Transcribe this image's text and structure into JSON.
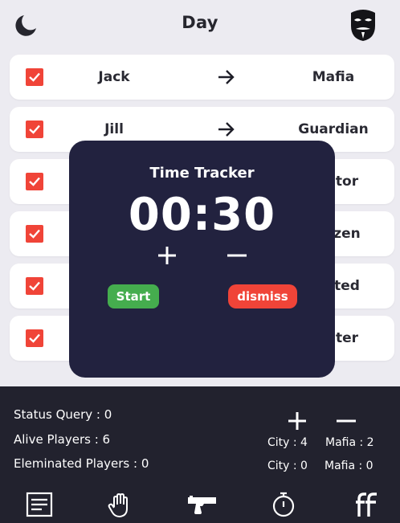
{
  "header": {
    "title": "Day",
    "left_icon": "moon-icon",
    "right_icon": "mask-icon"
  },
  "players": [
    {
      "name": "Jack",
      "role": "Mafia",
      "checked": true
    },
    {
      "name": "Jill",
      "role": "Guardian",
      "checked": true
    },
    {
      "name": "",
      "role": "tor",
      "checked": true
    },
    {
      "name": "",
      "role": "zen",
      "checked": true
    },
    {
      "name": "",
      "role": "ted",
      "checked": true
    },
    {
      "name": "",
      "role": "ter",
      "checked": true
    }
  ],
  "timer_modal": {
    "title": "Time Tracker",
    "time": "00:30",
    "plus_icon": "plus-icon",
    "minus_icon": "minus-icon",
    "start_label": "Start",
    "dismiss_label": "dismiss"
  },
  "stats": {
    "status_query": "Status Query : 0",
    "alive_players": "Alive Players : 6",
    "eliminated_players": "Eleminated Players : 0"
  },
  "counters": {
    "city_top": "City : 4",
    "mafia_top": "Mafia : 2",
    "city_bottom": "City : 0",
    "mafia_bottom": "Mafia : 0"
  },
  "bottom_nav": [
    "notes-icon",
    "hand-icon",
    "gun-icon",
    "stopwatch-icon",
    "ff-icon"
  ],
  "colors": {
    "accent_red": "#f04438",
    "start_green": "#45ad4e",
    "modal_bg": "#22223f",
    "panel_bg": "#22222e",
    "page_bg": "#ecebf1"
  }
}
